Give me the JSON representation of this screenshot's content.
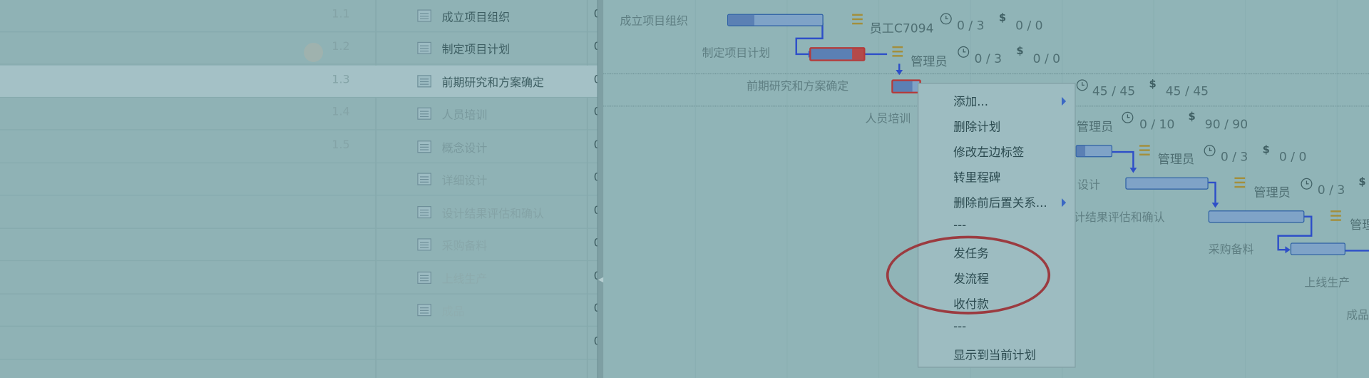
{
  "tasks": [
    {
      "num": "1.1",
      "name": "成立项目组织",
      "value": "0",
      "name_color": "#3e5f63"
    },
    {
      "num": "1.2",
      "name": "制定项目计划",
      "value": "0",
      "name_color": "#3e5f63"
    },
    {
      "num": "1.3",
      "name": "前期研究和方案确定",
      "value": "0",
      "name_color": "#3e5f63",
      "selected": true
    },
    {
      "num": "1.4",
      "name": "人员培训",
      "value": "0",
      "name_color": "#7a9a9e"
    },
    {
      "num": "1.5",
      "name": "概念设计",
      "value": "0",
      "name_color": "#7a9a9e"
    },
    {
      "num": "",
      "name": "详细设计",
      "value": "0",
      "name_color": "#80a0a3"
    },
    {
      "num": "",
      "name": "设计结果评估和确认",
      "value": "0",
      "name_color": "#84a3a6"
    },
    {
      "num": "",
      "name": "采购备料",
      "value": "0",
      "name_color": "#88a7aa"
    },
    {
      "num": "",
      "name": "上线生产",
      "value": "0",
      "name_color": "#8dabad"
    },
    {
      "num": "",
      "name": "成品",
      "value": "0",
      "name_color": "#8faeb0"
    },
    {
      "num": "",
      "name": "",
      "value": "0",
      "name_color": "#8faeb0"
    }
  ],
  "gantt": {
    "labels": {
      "t1": "成立项目组织",
      "t2": "制定项目计划",
      "t3": "前期研究和方案确定",
      "t4": "人员培训",
      "t5": "设计",
      "t6": "计结果评估和确认",
      "t7": "采购备料",
      "t8": "上线生产",
      "t9": "成品"
    },
    "meta": {
      "r1_res": "员工C7094",
      "r1_time": "0 / 3",
      "r1_cost": "0 / 0",
      "r2_res": "管理员",
      "r2_time": "0 / 3",
      "r2_cost": "0 / 0",
      "r3_time": "45 / 45",
      "r3_cost": "45 / 45",
      "r4_res": "管理员",
      "r4_time": "0 / 10",
      "r4_cost": "90 / 90",
      "r5_res": "管理员",
      "r5_time": "0 / 3",
      "r5_cost": "0 / 0",
      "r6_res": "管理员",
      "r6_time": "0 / 3",
      "r7_res": "管理"
    },
    "cost_symbol": "$"
  },
  "context_menu": {
    "items": [
      {
        "label": "添加...",
        "submenu": true
      },
      {
        "label": "删除计划",
        "submenu": false
      },
      {
        "label": "修改左边标签",
        "submenu": false
      },
      {
        "label": "转里程碑",
        "submenu": false
      },
      {
        "label": "删除前后置关系...",
        "submenu": true
      },
      {
        "label": "---",
        "submenu": false
      },
      {
        "label": "发任务",
        "submenu": false
      },
      {
        "label": "发流程",
        "submenu": false
      },
      {
        "label": "收付款",
        "submenu": false
      },
      {
        "label": "---",
        "submenu": false
      },
      {
        "label": "显示到当前计划",
        "submenu": false
      }
    ]
  },
  "colors": {
    "overlay": "#8fb3b6",
    "highlight_oval": "#9b3b40",
    "bar_border": "#2d5fa4",
    "critical": "#b44a4a"
  }
}
